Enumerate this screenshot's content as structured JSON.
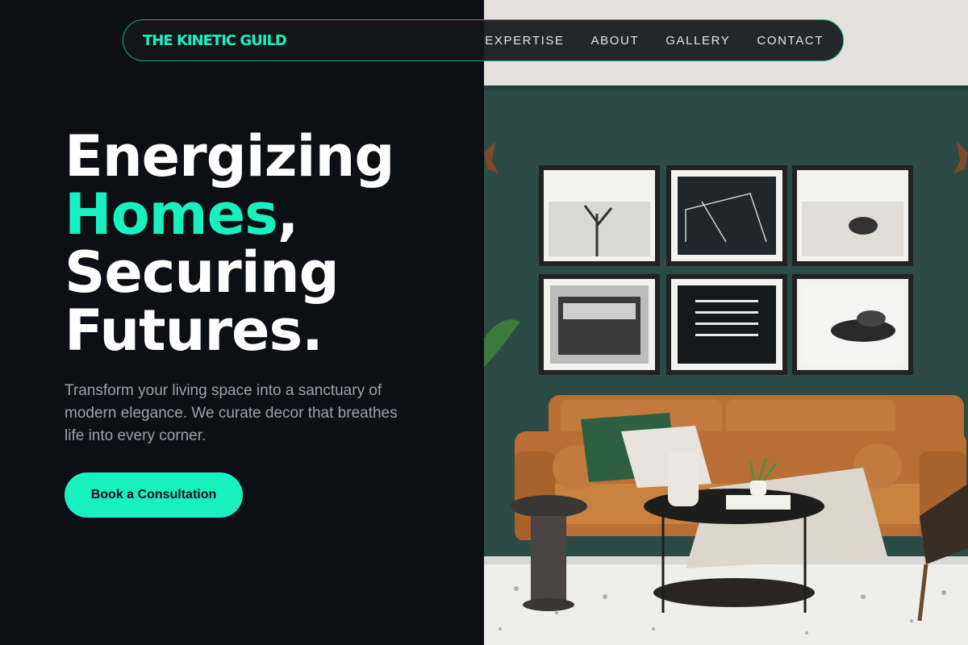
{
  "nav": {
    "brand": "THE KINETIC GUILD",
    "links": [
      "EXPERTISE",
      "ABOUT",
      "GALLERY",
      "CONTACT"
    ]
  },
  "hero": {
    "line1": "Energizing",
    "line2_accent": "Homes",
    "line2_rest": ",",
    "line3": "Securing",
    "line4": "Futures.",
    "description": "Transform your living space into a sanctuary of modern elegance. We curate decor that breathes life into every corner.",
    "cta": "Book a Consultation"
  },
  "colors": {
    "accent": "#19f0c0",
    "background": "#0c0f14",
    "wall": "#2c4a46",
    "sofa": "#c27a3e"
  }
}
